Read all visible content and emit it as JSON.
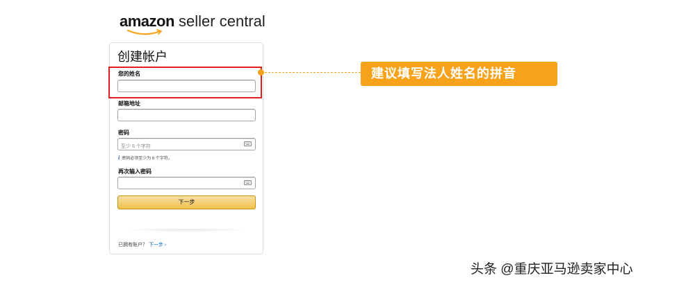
{
  "logo": {
    "brand": "amazon",
    "suffix": " seller central",
    "accent_color": "#f7a21b"
  },
  "card": {
    "title": "创建帐户",
    "fields": [
      {
        "label": "您的姓名",
        "value": "",
        "placeholder": ""
      },
      {
        "label": "邮箱地址",
        "value": "",
        "placeholder": ""
      },
      {
        "label": "密码",
        "value": "",
        "placeholder": "至少 6 个字符"
      },
      {
        "label": "再次输入密码",
        "value": "",
        "placeholder": ""
      }
    ],
    "password_hint": "密码必须至少为 6 个字符。",
    "password_hint_icon": "i",
    "next_button": "下一步",
    "signin_prompt": "已拥有账户？",
    "signin_link": "下一步",
    "signin_arrow": "›"
  },
  "annotation": {
    "callout_text": "建议填写法人姓名的拼音",
    "highlight_color": "#e01e1e",
    "callout_color": "#f7a21b"
  },
  "watermark": "头条 @重庆亚马逊卖家中心"
}
